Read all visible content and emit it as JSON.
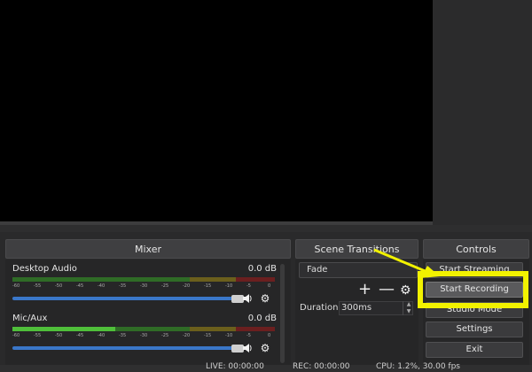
{
  "panels": {
    "mixer_title": "Mixer",
    "scene_transitions_title": "Scene Transitions",
    "controls_title": "Controls"
  },
  "mixer": {
    "tracks": [
      {
        "name": "Desktop Audio",
        "db": "0.0 dB",
        "level_fraction": 0.73
      },
      {
        "name": "Mic/Aux",
        "db": "0.0 dB",
        "level_fraction": 0.39
      }
    ],
    "tick_labels": [
      "-60",
      "-55",
      "-50",
      "-45",
      "-40",
      "-35",
      "-30",
      "-25",
      "-20",
      "-15",
      "-10",
      "-5",
      "0"
    ]
  },
  "transitions": {
    "selected": "Fade",
    "duration_label": "Duration",
    "duration_value": "300ms",
    "add_symbol": "+",
    "remove_symbol": "—"
  },
  "controls": {
    "start_streaming": "Start Streaming",
    "start_recording": "Start Recording",
    "studio_mode": "Studio Mode",
    "settings": "Settings",
    "exit": "Exit"
  },
  "status": {
    "live": "LIVE: 00:00:00",
    "rec": "REC: 00:00:00",
    "cpu": "CPU: 1.2%, 30.00 fps"
  },
  "colors": {
    "highlight": "#f2f200",
    "meter_green": "#4fbf3a",
    "meter_yellow": "#c9b531",
    "meter_red": "#c43a3a",
    "slider_blue": "#3a77c9"
  }
}
